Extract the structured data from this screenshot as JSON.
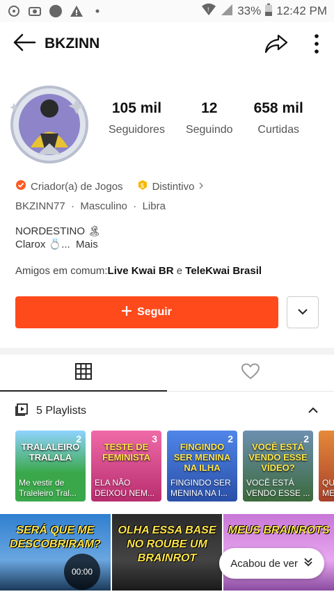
{
  "status": {
    "battery": "33%",
    "time": "12:42 PM"
  },
  "header": {
    "title": "BKZINN"
  },
  "stats": [
    {
      "num": "105 mil",
      "label": "Seguidores"
    },
    {
      "num": "12",
      "label": "Seguindo"
    },
    {
      "num": "658 mil",
      "label": "Curtidas"
    }
  ],
  "tags": {
    "creator": "Criador(a) de Jogos",
    "badge": "Distintivo"
  },
  "meta": {
    "id": "BKZINN77",
    "gender": "Masculino",
    "sign": "Libra"
  },
  "bio": {
    "line1": "NORDESTINO 🏝",
    "line2": "Clarox 💍...",
    "more": "Mais"
  },
  "friends": {
    "prefix": "Amigos em comum:",
    "a": "Live Kwai BR",
    "conj": "e",
    "b": "TeleKwai Brasil"
  },
  "follow": {
    "label": "Seguir"
  },
  "playlists": {
    "title": "5 Playlists",
    "items": [
      {
        "title": "TRALALEIRO TRALALA",
        "count": "2",
        "caption": "Me vestir de Traleleiro Tral...",
        "color": "#3aa84a"
      },
      {
        "title": "TESTE DE FEMINISTA",
        "count": "3",
        "caption": "ELA NÃO DEIXOU NEM...",
        "color": "#d8358a"
      },
      {
        "title": "FINGINDO SER MENINA NA ILHA",
        "count": "2",
        "caption": "FINGINDO SER MENINA NA I...",
        "color": "#3c6fd8"
      },
      {
        "title": "VOCÊ ESTÁ VENDO ESSE VÍDEO?",
        "count": "2",
        "caption": "VOCÊ ESTÁ VENDO ESSE ...",
        "color": "#4a8a4a"
      },
      {
        "title": "",
        "count": "",
        "caption": "QU ME",
        "color": "#d86a2a"
      }
    ]
  },
  "videos": [
    {
      "title": "SERÁ QUE ME DESCOBRIRAM?",
      "color": "#2f7fd0"
    },
    {
      "title": "OLHA ESSA BASE NO ROUBE UM BRAINROT",
      "color": "#222"
    },
    {
      "title": "MEUS BRAINROTS",
      "color": "#c877d8"
    }
  ],
  "player": {
    "time": "00:00"
  },
  "toast": {
    "label": "Acabou de ver"
  }
}
